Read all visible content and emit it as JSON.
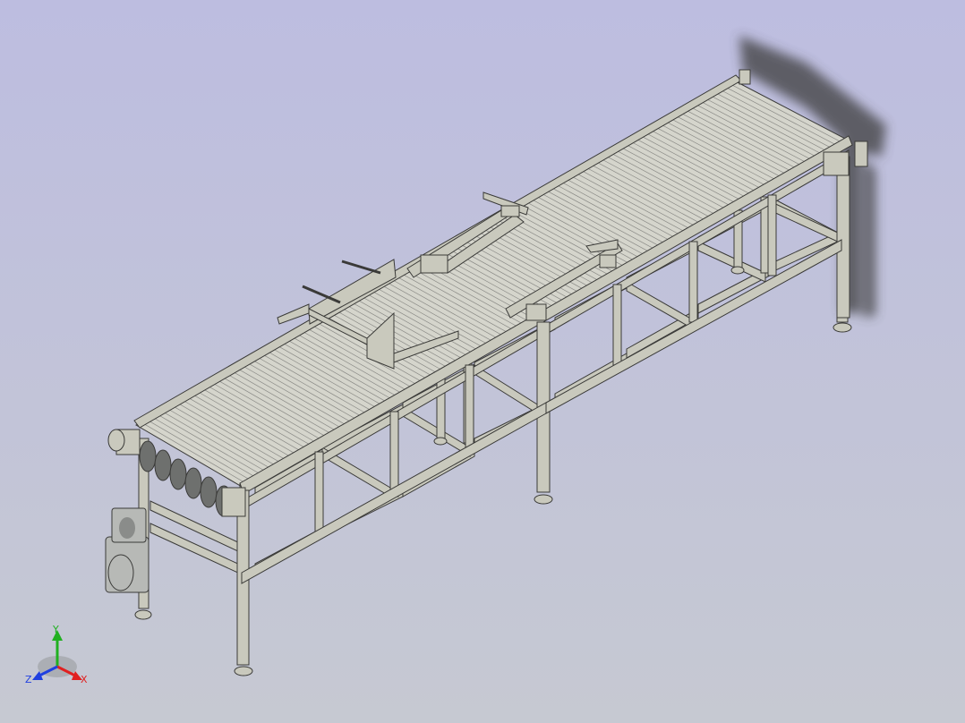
{
  "viewport": {
    "background_top": "#bdbde0",
    "background_bottom": "#c6c9d2"
  },
  "model": {
    "frame_color": "#c9c9bd",
    "frame_edge": "#3a3a38",
    "belt_color": "#d5d5cc",
    "belt_line": "#8a8a86",
    "shadow_color": "#3c3c3c",
    "motor_color": "#b7b9b6"
  },
  "triad": {
    "x_label": "X",
    "y_label": "Y",
    "z_label": "Z",
    "x_color": "#e02020",
    "y_color": "#20b020",
    "z_color": "#2040e0"
  }
}
